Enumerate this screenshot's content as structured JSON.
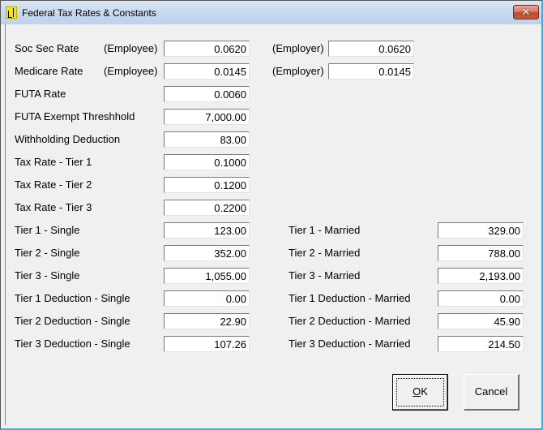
{
  "window": {
    "title": "Federal Tax Rates & Constants",
    "icon": "app-ledger-icon",
    "close_glyph": "✕"
  },
  "soc_sec": {
    "label": "Soc Sec Rate",
    "employee_label": "(Employee)",
    "employee_value": "0.0620",
    "employer_label": "(Employer)",
    "employer_value": "0.0620"
  },
  "medicare": {
    "label": "Medicare Rate",
    "employee_label": "(Employee)",
    "employee_value": "0.0145",
    "employer_label": "(Employer)",
    "employer_value": "0.0145"
  },
  "left_fields": [
    {
      "label": "FUTA Rate",
      "value": "0.0060"
    },
    {
      "label": "FUTA Exempt Threshhold",
      "value": "7,000.00"
    },
    {
      "label": "Withholding Deduction",
      "value": "83.00"
    },
    {
      "label": "Tax Rate - Tier 1",
      "value": "0.1000"
    },
    {
      "label": "Tax Rate - Tier 2",
      "value": "0.1200"
    },
    {
      "label": "Tax Rate - Tier 3",
      "value": "0.2200"
    },
    {
      "label": "Tier 1 - Single",
      "value": "123.00"
    },
    {
      "label": "Tier 2 - Single",
      "value": "352.00"
    },
    {
      "label": "Tier 3 - Single",
      "value": "1,055.00"
    },
    {
      "label": "Tier 1 Deduction - Single",
      "value": "0.00"
    },
    {
      "label": "Tier 2 Deduction - Single",
      "value": "22.90"
    },
    {
      "label": "Tier 3 Deduction - Single",
      "value": "107.26"
    }
  ],
  "right_fields": [
    {
      "label": "Tier 1 - Married",
      "value": "329.00"
    },
    {
      "label": "Tier 2 - Married",
      "value": "788.00"
    },
    {
      "label": "Tier 3 - Married",
      "value": "2,193.00"
    },
    {
      "label": "Tier 1 Deduction - Married",
      "value": "0.00"
    },
    {
      "label": "Tier 2 Deduction - Married",
      "value": "45.90"
    },
    {
      "label": "Tier 3 Deduction - Married",
      "value": "214.50"
    }
  ],
  "buttons": {
    "ok_mnemonic": "O",
    "ok_rest": "K",
    "cancel": "Cancel"
  }
}
